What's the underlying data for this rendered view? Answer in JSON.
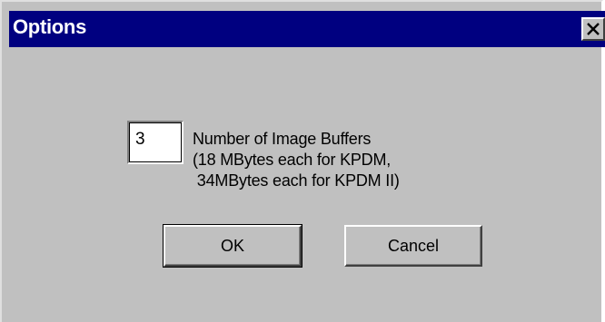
{
  "window": {
    "title": "Options"
  },
  "buffers": {
    "value": "3",
    "label_lines": [
      "Number of Image Buffers",
      "(18 MBytes each for KPDM,",
      " 34MBytes each for KPDM II)"
    ]
  },
  "buttons": {
    "ok_label": "OK",
    "cancel_label": "Cancel"
  },
  "icons": {
    "close": "close-icon"
  },
  "colors": {
    "titlebar": "#000080",
    "dialog_face": "#c0c0c0"
  }
}
